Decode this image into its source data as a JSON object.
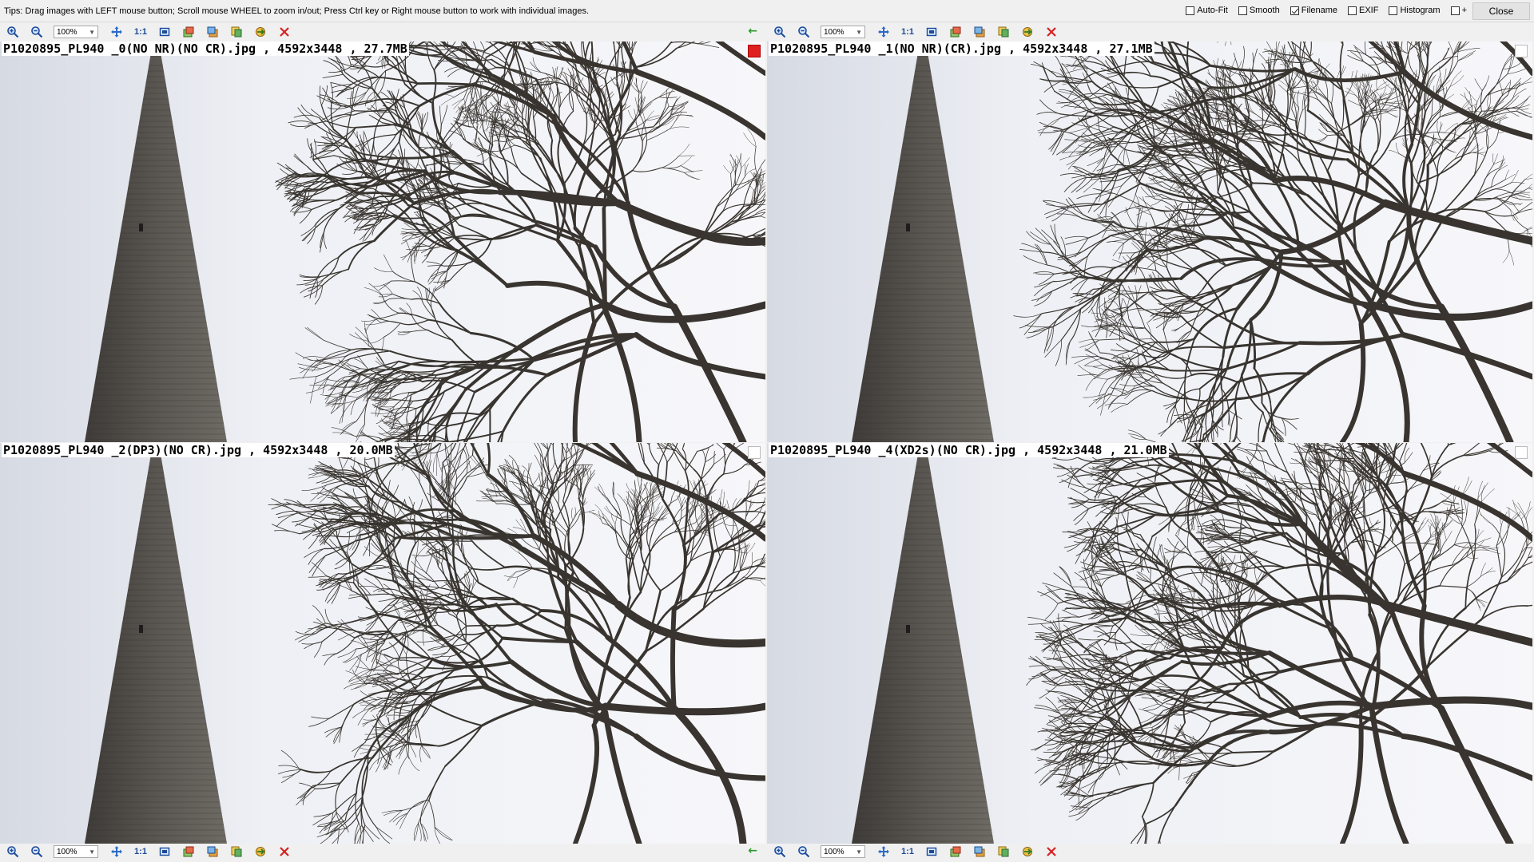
{
  "tips": "Tips: Drag images with LEFT mouse button; Scroll mouse WHEEL to zoom in/out; Press Ctrl key or Right mouse button to work with individual images.",
  "options": [
    {
      "label": "Auto-Fit",
      "checked": false
    },
    {
      "label": "Smooth",
      "checked": false
    },
    {
      "label": "Filename",
      "checked": true
    },
    {
      "label": "EXIF",
      "checked": false
    },
    {
      "label": "Histogram",
      "checked": false
    },
    {
      "label": "+",
      "checked": false
    }
  ],
  "close_label": "Close",
  "toolbar": {
    "zoom_value": "100%",
    "one_to_one": "1:1",
    "icons": [
      "zoom-in-icon",
      "zoom-out-icon",
      "fit-icon",
      "actual-size-icon",
      "rotate-left-icon",
      "rotate-right-icon",
      "copy-icon",
      "refresh-icon",
      "close-x-icon"
    ],
    "sync_arrow": "←"
  },
  "panels": [
    {
      "label": "P1020895_PL940 _0(NO NR)(NO CR).jpg , 4592x3448 , 27.7MB",
      "selected": true
    },
    {
      "label": "P1020895_PL940 _1(NO NR)(CR).jpg , 4592x3448 , 27.1MB",
      "selected": false
    },
    {
      "label": "P1020895_PL940 _2(DP3)(NO CR).jpg , 4592x3448 , 20.0MB",
      "selected": false
    },
    {
      "label": "P1020895_PL940 _4(XD2s)(NO CR).jpg , 4592x3448 , 21.0MB",
      "selected": false
    }
  ],
  "colors": {
    "sky": "#eef0f4",
    "spire": "#4f4c48",
    "branches": "#2b2620",
    "selected": "#e02020"
  }
}
